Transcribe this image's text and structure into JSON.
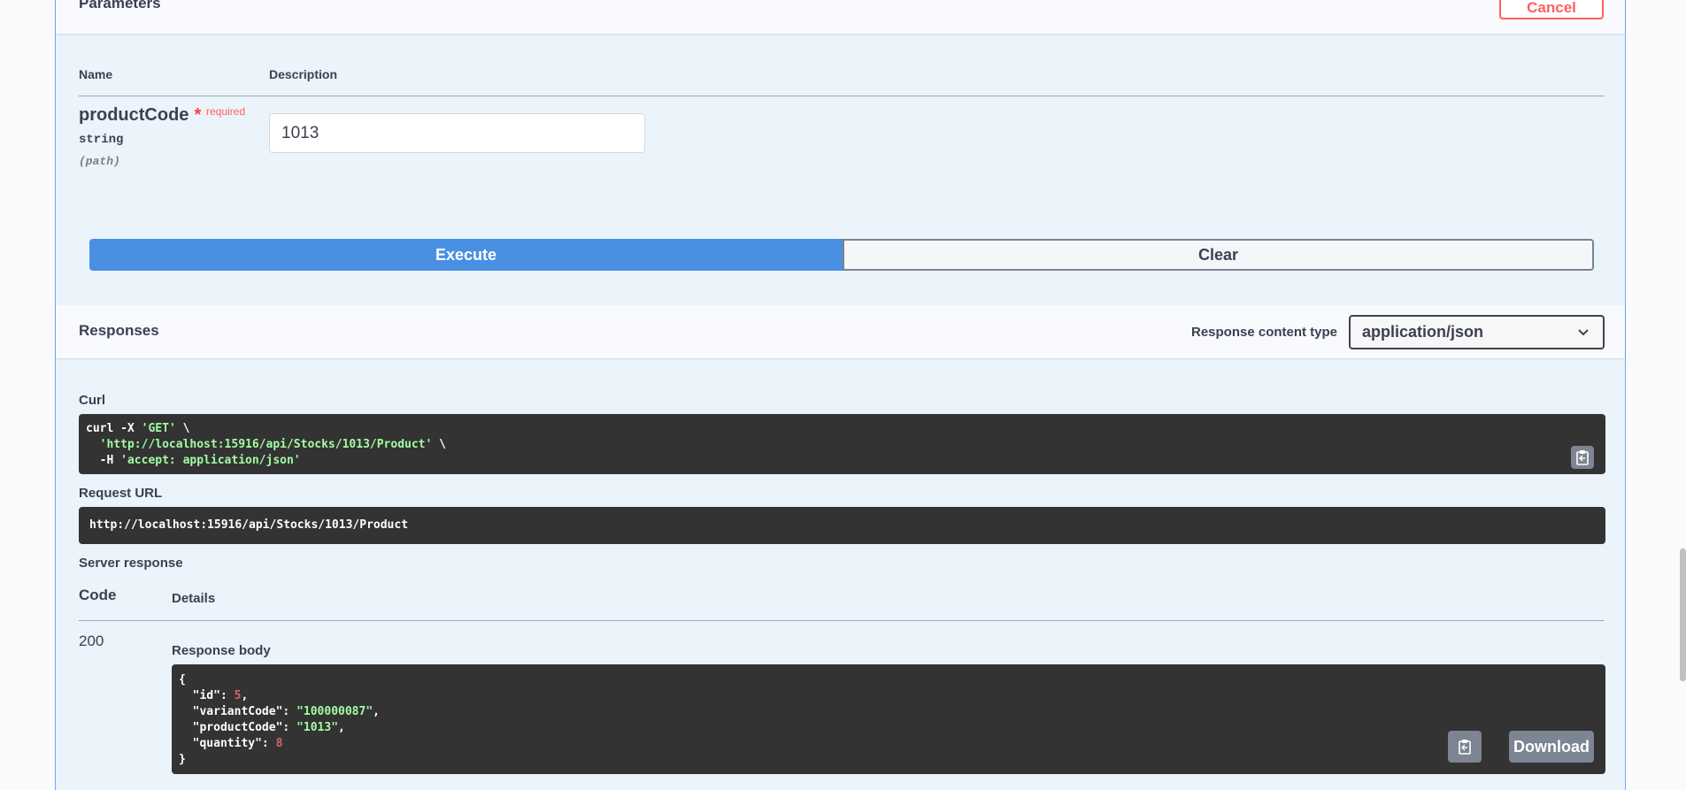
{
  "parameters": {
    "title": "Parameters",
    "cancel_label": "Cancel",
    "columns": {
      "name": "Name",
      "description": "Description"
    },
    "items": [
      {
        "name": "productCode",
        "required_star": "*",
        "required_label": "required",
        "type": "string",
        "in": "(path)",
        "value": "1013"
      }
    ]
  },
  "actions": {
    "execute_label": "Execute",
    "clear_label": "Clear"
  },
  "responses": {
    "title": "Responses",
    "content_type_label": "Response content type",
    "content_type_value": "application/json",
    "curl_label": "Curl",
    "curl_lines": [
      [
        "curl -X ",
        "'GET'",
        " \\"
      ],
      [
        "  ",
        "'http://localhost:15916/api/Stocks/1013/Product'",
        " \\"
      ],
      [
        "  -H ",
        "'accept: application/json'",
        ""
      ]
    ],
    "request_url_label": "Request URL",
    "request_url": "http://localhost:15916/api/Stocks/1013/Product",
    "server_response_label": "Server response",
    "code_header": "Code",
    "details_header": "Details",
    "status_code": "200",
    "response_body_label": "Response body",
    "response_body": [
      {
        "key": "id",
        "value": "5",
        "kind": "num"
      },
      {
        "key": "variantCode",
        "value": "\"100000087\"",
        "kind": "str"
      },
      {
        "key": "productCode",
        "value": "\"1013\"",
        "kind": "str"
      },
      {
        "key": "quantity",
        "value": "8",
        "kind": "num"
      }
    ],
    "download_label": "Download"
  },
  "icons": {
    "copy": "clipboard-copy-icon",
    "chevron": "chevron-down-icon"
  }
}
